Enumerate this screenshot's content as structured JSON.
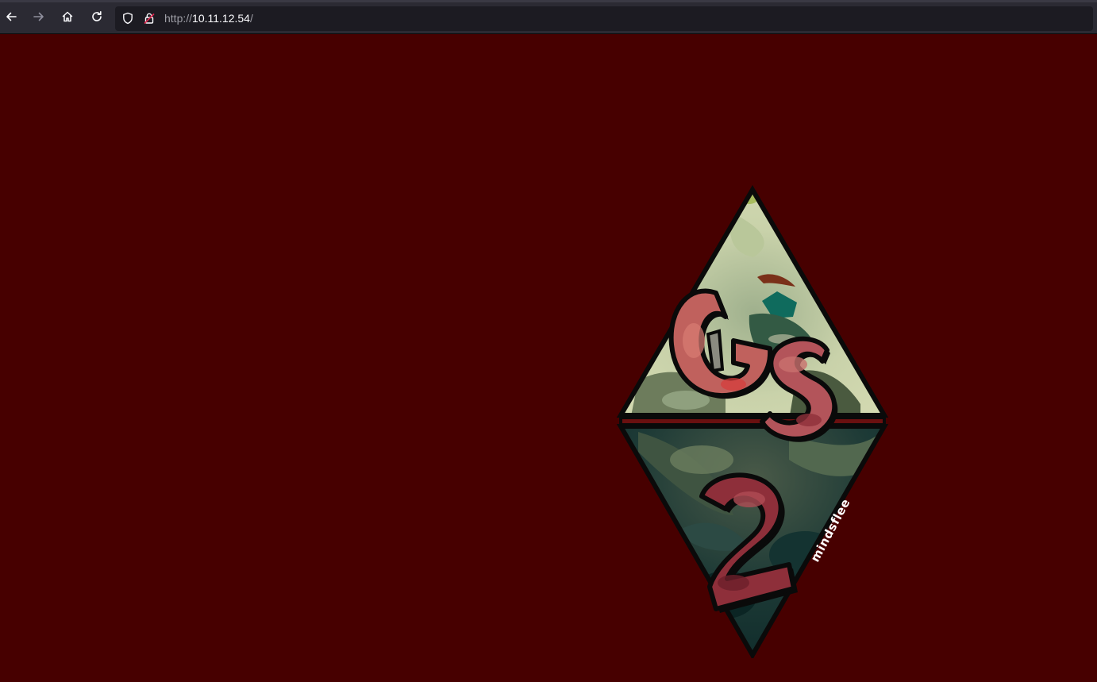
{
  "browser": {
    "url_scheme": "http://",
    "url_host": "10.11.12.54",
    "url_path": "/",
    "icons": {
      "back": "arrow-left-icon",
      "forward": "arrow-right-icon",
      "home": "home-icon",
      "reload": "reload-icon",
      "tracking": "shield-icon",
      "insecure": "insecure-lock-icon"
    }
  },
  "page": {
    "background": "#470000",
    "logo": {
      "signature": "mindsflee"
    }
  }
}
